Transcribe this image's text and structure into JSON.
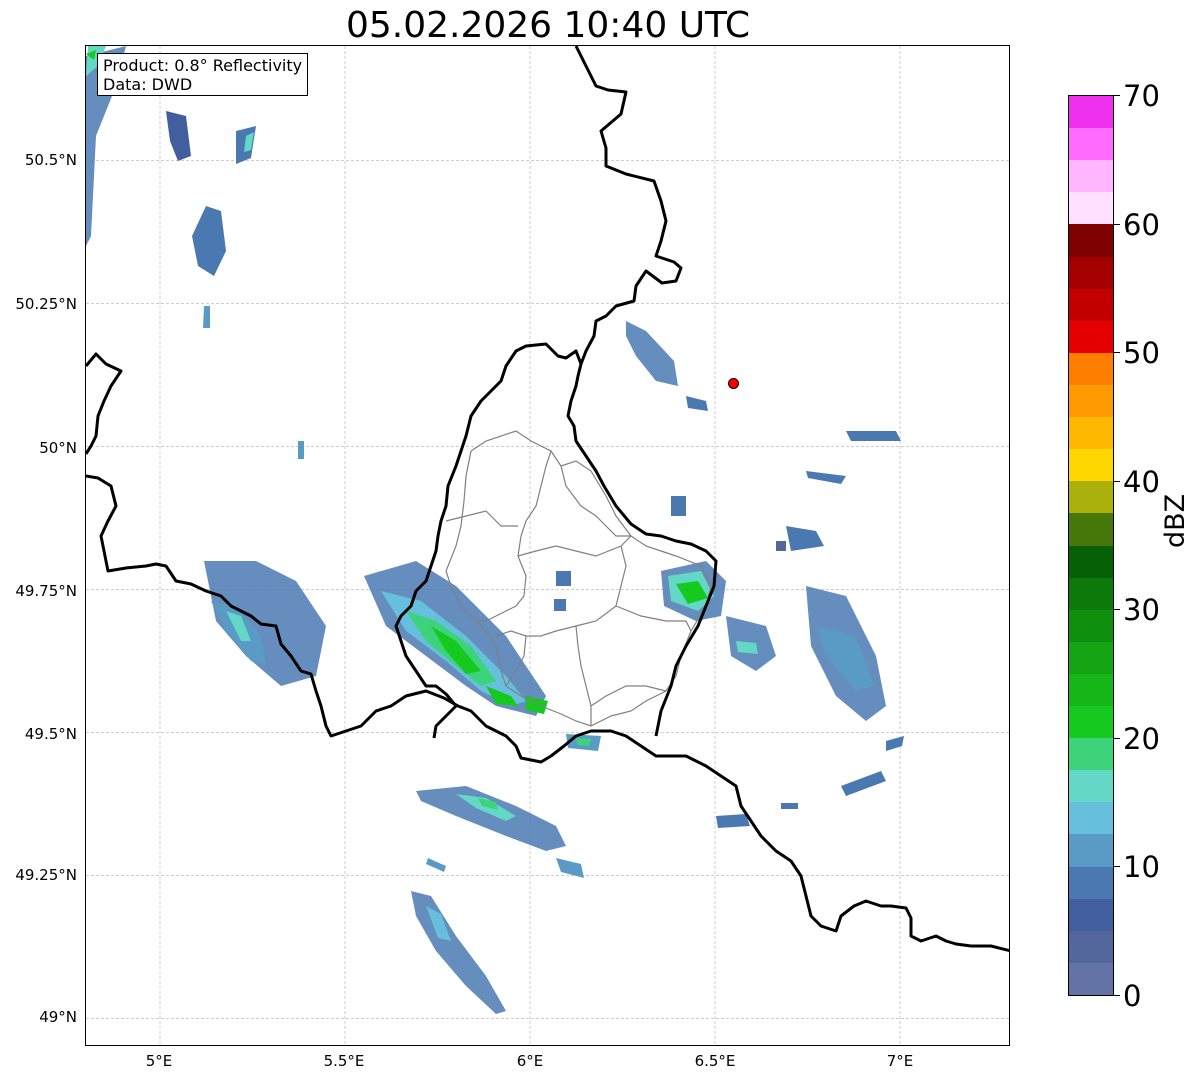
{
  "title": "05.02.2026 10:40 UTC",
  "info": {
    "product": "Product: 0.8° Reflectivity",
    "data": "Data: DWD"
  },
  "map": {
    "y_ticks": [
      "50.5°N",
      "50.25°N",
      "50°N",
      "49.75°N",
      "49.5°N",
      "49.25°N",
      "49°N"
    ],
    "x_ticks": [
      "5°E",
      "5.5°E",
      "6°E",
      "6.5°E",
      "7°E"
    ],
    "lon_range": [
      4.8,
      7.3
    ],
    "lat_range": [
      48.95,
      50.7
    ],
    "marker": {
      "lon": 6.55,
      "lat": 50.11,
      "color": "#ff0000"
    },
    "border_color": "#000000",
    "district_color": "#808080",
    "grid": true
  },
  "colorbar": {
    "label": "dBZ",
    "ticks": [
      "0",
      "10",
      "20",
      "30",
      "40",
      "50",
      "60",
      "70"
    ],
    "range": [
      0,
      70
    ],
    "colors": [
      "#6473a6",
      "#53679d",
      "#415e9f",
      "#4a79b1",
      "#5a9bc6",
      "#66bfdc",
      "#63d8c6",
      "#3dd37a",
      "#16c91f",
      "#14b717",
      "#12a412",
      "#0f8f0e",
      "#0b7a0b",
      "#056006",
      "#467709",
      "#aab10a",
      "#ffd700",
      "#ffb800",
      "#ff9a00",
      "#ff7e00",
      "#e40000",
      "#c30000",
      "#a40000",
      "#7e0000",
      "#ffe0ff",
      "#ffb6ff",
      "#ff6bff",
      "#ee30ee"
    ]
  }
}
